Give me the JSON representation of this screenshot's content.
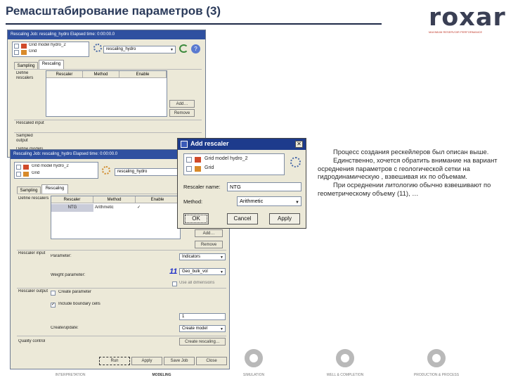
{
  "slide": {
    "title": "Ремасштабирование параметров (3)",
    "logo_text": "roxar",
    "logo_tagline": "MAXIMUM RESERVOIR PERFORMANCE",
    "description": [
      "Процесс создания рескейлеров был описан выше.",
      "Единственно, хочется обратить внимание на вариант осреднения параметров с геологической сетки на гидродинамическую , взвешивая их по объемам.",
      "При осреднении литологию обычно взвешивают по геометрическому объему (11), …"
    ]
  },
  "back_window": {
    "title": "Rescaling  Job: rescaling_hydro  Elapsed time: 0:00:00.0",
    "grids": [
      "Grid model hydro_2",
      "Grid"
    ],
    "job_name": "rescaling_hydro",
    "tabs": [
      "Sampling",
      "Rescaling"
    ],
    "sections": [
      "Define rescalers",
      "Rescaled input",
      "Sampled output",
      "Define models"
    ],
    "columns": [
      "Rescaler",
      "Method",
      "Enable"
    ],
    "buttons": [
      "Add…",
      "Remove"
    ]
  },
  "front_window": {
    "title": "Rescaling  Job: rescaling_hydro  Elapsed time: 0:00:00.0",
    "grids": [
      "Grid model hydro_2",
      "Grid"
    ],
    "job_name": "rescaling_hydro",
    "tabs": [
      "Sampling",
      "Rescaling"
    ],
    "columns": [
      "Rescaler",
      "Method",
      "Enable"
    ],
    "row": {
      "rescaler": "NTG",
      "method": "Arithmetic",
      "enable": "✓"
    },
    "side_buttons": [
      "Add…",
      "Remove"
    ],
    "sections": {
      "define": "Define rescalers",
      "input": "Rescaler input",
      "output": "Rescaler output",
      "quality": "Quality control"
    },
    "labels": {
      "parameter": "Parameter:",
      "weight": "Weight parameter:",
      "create_poro": "Create parameter",
      "include_boundary": "Include boundary cells",
      "create_update": "Create/update:"
    },
    "values": {
      "parameter": "Indicators",
      "weight": "Geo_bulk_vol",
      "annotation": "11",
      "use_all": "Use all dimensions",
      "create_update": "Create model",
      "include_value": "1",
      "quality": "Create rescaling…"
    },
    "footer_buttons": [
      "Run",
      "Apply",
      "Save Job",
      "Close"
    ]
  },
  "dialog": {
    "title": "Add rescaler",
    "grids": [
      "Grid model hydro_2",
      "Grid"
    ],
    "labels": {
      "name": "Rescaler name:",
      "method": "Method:"
    },
    "values": {
      "name": "NTG",
      "method": "Arithmetic"
    },
    "buttons": {
      "ok": "OK",
      "cancel": "Cancel",
      "apply": "Apply"
    }
  },
  "navigation": [
    {
      "label": "INTERPRETATION",
      "active": false
    },
    {
      "label": "MODELING",
      "active": true
    },
    {
      "label": "SIMULATION",
      "active": false
    },
    {
      "label": "WELL & COMPLETION",
      "active": false
    },
    {
      "label": "PRODUCTION & PROCESS",
      "active": false
    }
  ],
  "colors": {
    "title_bar": "#2f50a0",
    "dialog_title": "#1d3b8c",
    "swatch_red": "#d04a2a",
    "swatch_orange": "#d88a2a",
    "annotation": "#2030c8",
    "nav_ring": "#b9b9b9"
  }
}
